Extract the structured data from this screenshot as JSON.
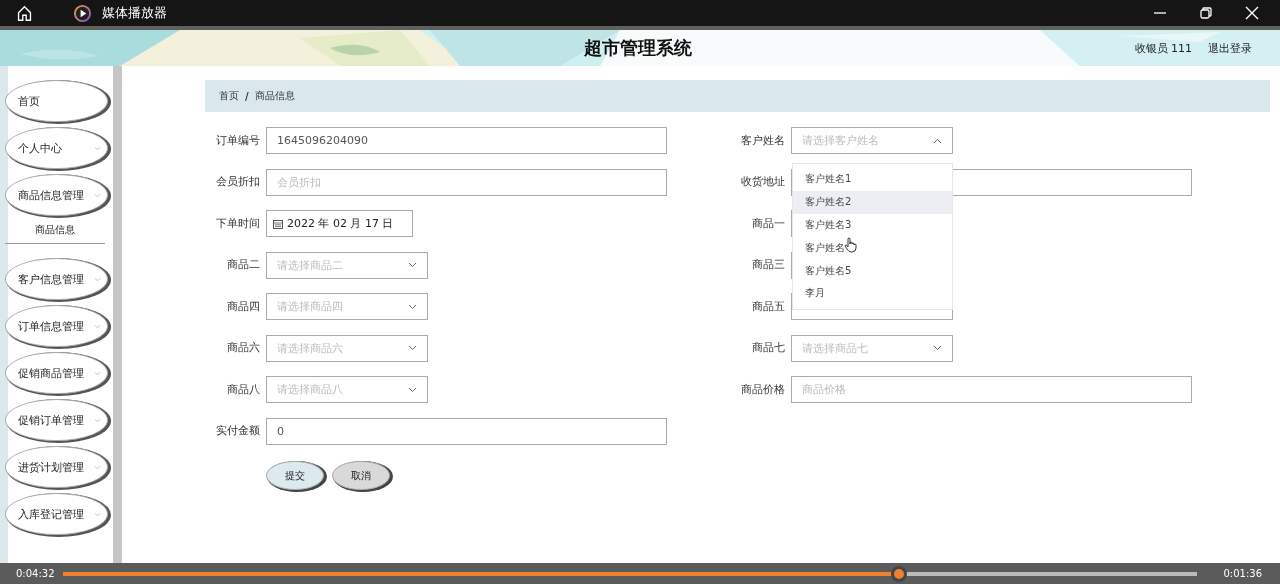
{
  "player": {
    "title": "媒体播放器",
    "elapsed": "0:04:32",
    "remaining": "0:01:36",
    "progress": {
      "level": 0.737
    }
  },
  "header": {
    "title": "超市管理系统",
    "user": "收银员 111",
    "logout": "退出登录"
  },
  "sidebar": {
    "items": [
      {
        "label": "首页",
        "kind": "link"
      },
      {
        "label": "个人中心",
        "kind": "group"
      },
      {
        "label": "商品信息管理",
        "kind": "group",
        "children": [
          {
            "label": "商品信息"
          }
        ]
      },
      {
        "label": "客户信息管理",
        "kind": "group"
      },
      {
        "label": "订单信息管理",
        "kind": "group"
      },
      {
        "label": "促销商品管理",
        "kind": "group"
      },
      {
        "label": "促销订单管理",
        "kind": "group"
      },
      {
        "label": "进货计划管理",
        "kind": "group"
      },
      {
        "label": "入库登记管理",
        "kind": "group"
      }
    ]
  },
  "breadcrumb": {
    "separator": "/",
    "items": [
      "首页",
      "商品信息"
    ]
  },
  "form": {
    "left": [
      {
        "label": "订单编号",
        "kind": "text",
        "value": "1645096204090"
      },
      {
        "label": "会员折扣",
        "kind": "text",
        "placeholder": "会员折扣"
      },
      {
        "label": "下单时间",
        "kind": "date",
        "value": "2022 年 02 月 17 日"
      },
      {
        "label": "商品二",
        "kind": "select",
        "placeholder": "请选择商品二",
        "open": false
      },
      {
        "label": "商品四",
        "kind": "select",
        "placeholder": "请选择商品四",
        "open": false
      },
      {
        "label": "商品六",
        "kind": "select",
        "placeholder": "请选择商品六",
        "open": false
      },
      {
        "label": "商品八",
        "kind": "select",
        "placeholder": "请选择商品八",
        "open": false
      },
      {
        "label": "实付金额",
        "kind": "text",
        "value": "0"
      }
    ],
    "right": [
      {
        "label": "客户姓名",
        "kind": "select",
        "placeholder": "请选择客户姓名",
        "open": true,
        "options": [
          {
            "label": "客户姓名1",
            "highlighted": false,
            "cursor": false
          },
          {
            "label": "客户姓名2",
            "highlighted": true,
            "cursor": false
          },
          {
            "label": "客户姓名3",
            "highlighted": false,
            "cursor": false
          },
          {
            "label": "客户姓名",
            "highlighted": false,
            "cursor": true
          },
          {
            "label": "客户姓名5",
            "highlighted": false,
            "cursor": false
          },
          {
            "label": "李月",
            "highlighted": false,
            "cursor": false
          }
        ]
      },
      {
        "label": "收货地址",
        "kind": "text"
      },
      {
        "label": "商品一",
        "kind": "select"
      },
      {
        "label": "商品三",
        "kind": "select"
      },
      {
        "label": "商品五",
        "kind": "select"
      },
      {
        "label": "商品七",
        "kind": "select",
        "placeholder": "请选择商品七",
        "open": false
      },
      {
        "label": "商品价格",
        "kind": "text",
        "placeholder": "商品价格"
      }
    ]
  },
  "buttons": [
    {
      "label": "提交",
      "kind": "primary"
    },
    {
      "label": "取消",
      "kind": "secondary"
    }
  ]
}
